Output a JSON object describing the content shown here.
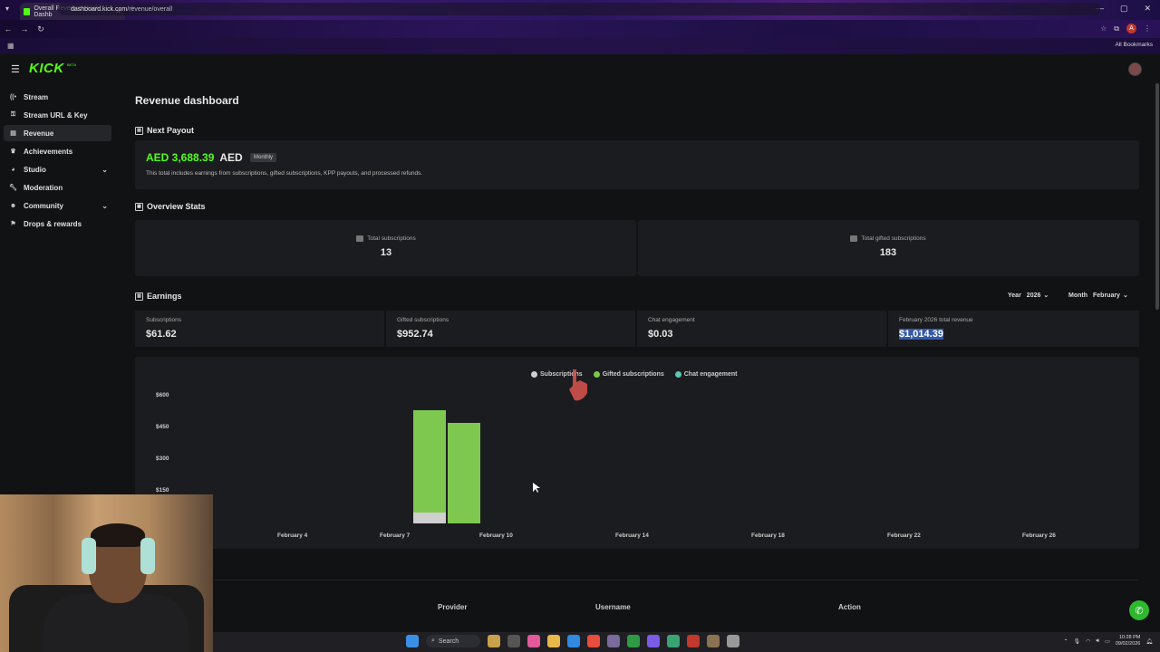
{
  "browser": {
    "tab_title": "Overall Revenue - Kick Dashb",
    "url_host": "dashboard.kick.com",
    "url_path": "/revenue/overall",
    "profile_letter": "A",
    "all_bookmarks": "All Bookmarks"
  },
  "app": {
    "logo": "KICK",
    "logo_sup": "BETA"
  },
  "sidebar": {
    "items": [
      {
        "label": "Stream",
        "icon": "signal-icon"
      },
      {
        "label": "Stream URL & Key",
        "icon": "key-icon"
      },
      {
        "label": "Revenue",
        "icon": "chart-icon",
        "active": true
      },
      {
        "label": "Achievements",
        "icon": "trophy-icon"
      },
      {
        "label": "Studio",
        "icon": "palette-icon",
        "expandable": true
      },
      {
        "label": "Moderation",
        "icon": "wrench-icon"
      },
      {
        "label": "Community",
        "icon": "users-icon",
        "expandable": true
      },
      {
        "label": "Drops & rewards",
        "icon": "gift-icon"
      }
    ]
  },
  "page": {
    "title": "Revenue dashboard"
  },
  "payout": {
    "section_title": "Next Payout",
    "amount": "AED 3,688.39",
    "currency": "AED",
    "badge": "Monthly",
    "description": "This total includes earnings from subscriptions, gifted subscriptions, KPP payouts, and processed refunds."
  },
  "overview": {
    "section_title": "Overview Stats",
    "total_subs_label": "Total subscriptions",
    "total_subs_value": "13",
    "total_gifted_label": "Total gifted subscriptions",
    "total_gifted_value": "183"
  },
  "earnings": {
    "section_title": "Earnings",
    "year_label": "Year",
    "year_value": "2026",
    "month_label": "Month",
    "month_value": "February",
    "cells": [
      {
        "label": "Subscriptions",
        "value": "$61.62"
      },
      {
        "label": "Gifted subscriptions",
        "value": "$952.74"
      },
      {
        "label": "Chat engagement",
        "value": "$0.03"
      },
      {
        "label": "February 2026 total revenue",
        "value": "$1,014.39"
      }
    ]
  },
  "colors": {
    "accent": "#53fc18",
    "subscriptions": "#cfcfcf",
    "gifted": "#7ec850",
    "chat": "#5cc6b4"
  },
  "chart_data": {
    "type": "bar",
    "stacked": true,
    "legend": [
      "Subscriptions",
      "Gifted subscriptions",
      "Chat engagement"
    ],
    "y_ticks": [
      "$600",
      "$450",
      "$300",
      "$150"
    ],
    "x_ticks": [
      "February 4",
      "February 7",
      "February 10",
      "February 14",
      "February 18",
      "February 22",
      "February 26"
    ],
    "ylim": [
      0,
      600
    ],
    "series": [
      {
        "name": "Subscriptions",
        "points": [
          {
            "x": "February 8",
            "y": 50
          },
          {
            "x": "February 9",
            "y": 0
          }
        ]
      },
      {
        "name": "Gifted subscriptions",
        "points": [
          {
            "x": "February 8",
            "y": 485
          },
          {
            "x": "February 9",
            "y": 474
          }
        ]
      },
      {
        "name": "Chat engagement",
        "points": [
          {
            "x": "February 8",
            "y": 0
          },
          {
            "x": "February 9",
            "y": 0
          }
        ]
      }
    ]
  },
  "table": {
    "headers": [
      "Provider",
      "Username",
      "Action"
    ]
  },
  "taskbar": {
    "search": "Search",
    "time": "10:28 PM",
    "date": "09/02/2026"
  }
}
